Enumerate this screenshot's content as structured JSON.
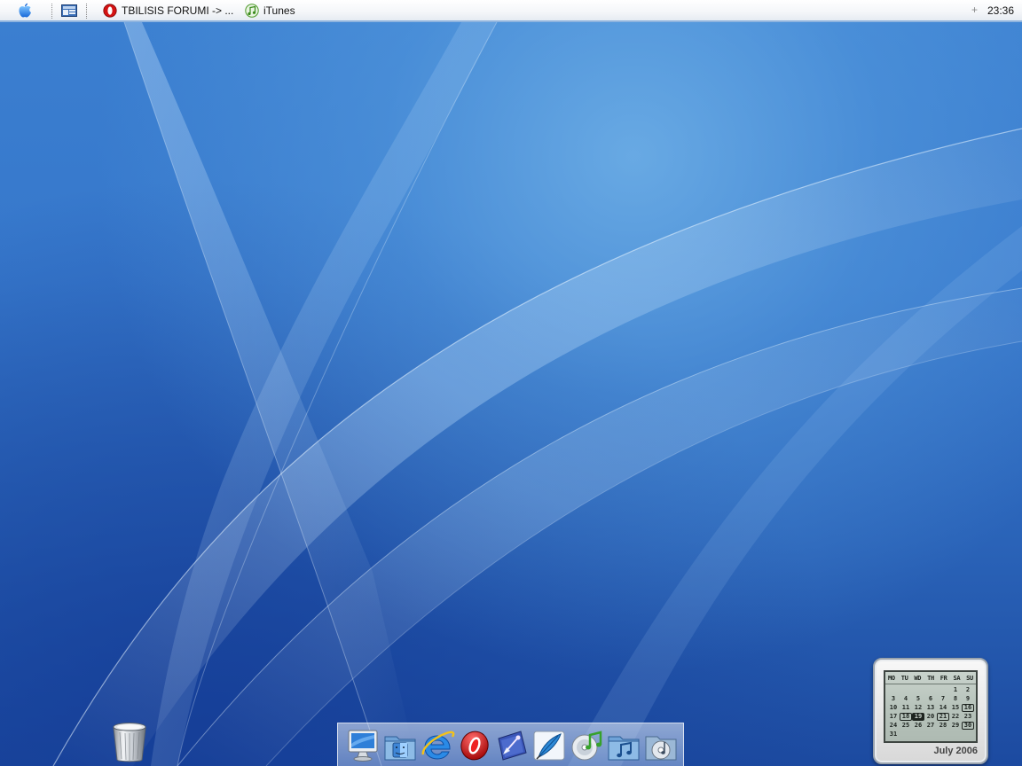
{
  "taskbar": {
    "tasks": [
      {
        "label": "TBILISIS FORUMI -> ...",
        "icon": "opera-icon"
      },
      {
        "label": "iTunes",
        "icon": "itunes-icon"
      }
    ],
    "tray_plus": "+",
    "clock": "23:36"
  },
  "desktop": {
    "trash_icon": "trash-icon"
  },
  "dock": {
    "items": [
      {
        "icon": "my-computer-icon"
      },
      {
        "icon": "finder-icon"
      },
      {
        "icon": "internet-explorer-icon"
      },
      {
        "icon": "opera-icon"
      },
      {
        "icon": "design-app-icon"
      },
      {
        "icon": "feather-icon"
      },
      {
        "icon": "itunes-icon"
      },
      {
        "icon": "music-folder-icon"
      },
      {
        "icon": "media-player-icon"
      }
    ]
  },
  "calendar": {
    "weekdays": [
      "MO",
      "TU",
      "WD",
      "TH",
      "FR",
      "SA",
      "SU"
    ],
    "weeks": [
      [
        "",
        "",
        "",
        "",
        "",
        "1",
        "2"
      ],
      [
        "3",
        "4",
        "5",
        "6",
        "7",
        "8",
        "9"
      ],
      [
        "10",
        "11",
        "12",
        "13",
        "14",
        "15",
        "16"
      ],
      [
        "17",
        "18",
        "19",
        "20",
        "21",
        "22",
        "23"
      ],
      [
        "24",
        "25",
        "26",
        "27",
        "28",
        "29",
        "30"
      ],
      [
        "31",
        "",
        "",
        "",
        "",
        "",
        ""
      ]
    ],
    "today": "19",
    "month_year": "July  2006"
  },
  "colors": {
    "taskbar_border": "#8fb4de",
    "wallpaper_base": "#3677cb",
    "lcd_background": "#c9d3cc"
  }
}
